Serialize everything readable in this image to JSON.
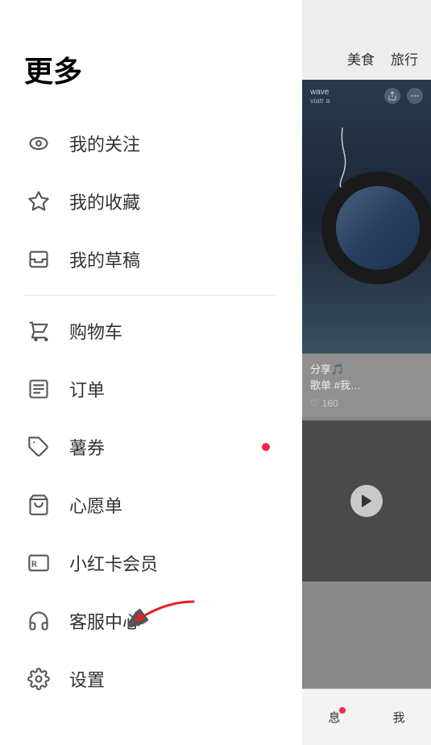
{
  "menu": {
    "title": "更多",
    "items": [
      {
        "id": "my-follow",
        "label": "我的关注",
        "icon": "eye",
        "badge": false,
        "divider_after": false
      },
      {
        "id": "my-favorites",
        "label": "我的收藏",
        "icon": "star",
        "badge": false,
        "divider_after": false
      },
      {
        "id": "my-drafts",
        "label": "我的草稿",
        "icon": "inbox",
        "badge": false,
        "divider_after": true
      },
      {
        "id": "shopping-cart",
        "label": "购物车",
        "icon": "cart",
        "badge": false,
        "divider_after": false
      },
      {
        "id": "orders",
        "label": "订单",
        "icon": "list",
        "badge": false,
        "divider_after": false
      },
      {
        "id": "coupons",
        "label": "薯券",
        "icon": "tag",
        "badge": true,
        "divider_after": false
      },
      {
        "id": "wishlist",
        "label": "心愿单",
        "icon": "bag",
        "badge": false,
        "divider_after": false
      },
      {
        "id": "vip",
        "label": "小红卡会员",
        "icon": "card",
        "badge": false,
        "divider_after": false
      },
      {
        "id": "customer-service",
        "label": "客服中心",
        "icon": "headset",
        "badge": false,
        "divider_after": false
      },
      {
        "id": "settings",
        "label": "设置",
        "icon": "gear",
        "badge": false,
        "divider_after": false
      }
    ]
  },
  "right_panel": {
    "categories": [
      "美食",
      "旅行"
    ],
    "card1": {
      "user": "wave",
      "subtitle": "viatra",
      "content_line1": "分享🎵",
      "content_line2": "歌单 #我…",
      "likes": "160"
    },
    "card2": {},
    "bottom_nav": [
      {
        "label": "息",
        "badge": true
      },
      {
        "label": "我",
        "badge": false
      }
    ]
  },
  "annotation": {
    "arrow_color": "#e82020"
  }
}
